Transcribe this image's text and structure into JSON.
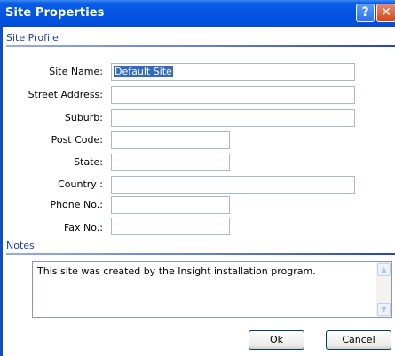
{
  "window": {
    "title": "Site Properties"
  },
  "titlebar": {
    "help_glyph": "?",
    "close_glyph": "✕"
  },
  "site_profile": {
    "section_label": "Site Profile",
    "fields": {
      "site_name": {
        "label": "Site Name:",
        "value": "Default Site"
      },
      "street_address": {
        "label": "Street Address:",
        "value": ""
      },
      "suburb": {
        "label": "Suburb:",
        "value": ""
      },
      "post_code": {
        "label": "Post Code:",
        "value": ""
      },
      "state": {
        "label": "State:",
        "value": ""
      },
      "country": {
        "label": "Country :",
        "value": ""
      },
      "phone": {
        "label": "Phone No.:",
        "value": ""
      },
      "fax": {
        "label": "Fax No.:",
        "value": ""
      }
    }
  },
  "notes": {
    "section_label": "Notes",
    "text": "This site was created by the Insight installation program.",
    "scroll_up": "▲",
    "scroll_down": "▼"
  },
  "buttons": {
    "ok": "Ok",
    "cancel": "Cancel"
  },
  "colors": {
    "titlebar": "#0454e0",
    "section_text": "#1a3fa8",
    "selection": "#316ac5"
  }
}
